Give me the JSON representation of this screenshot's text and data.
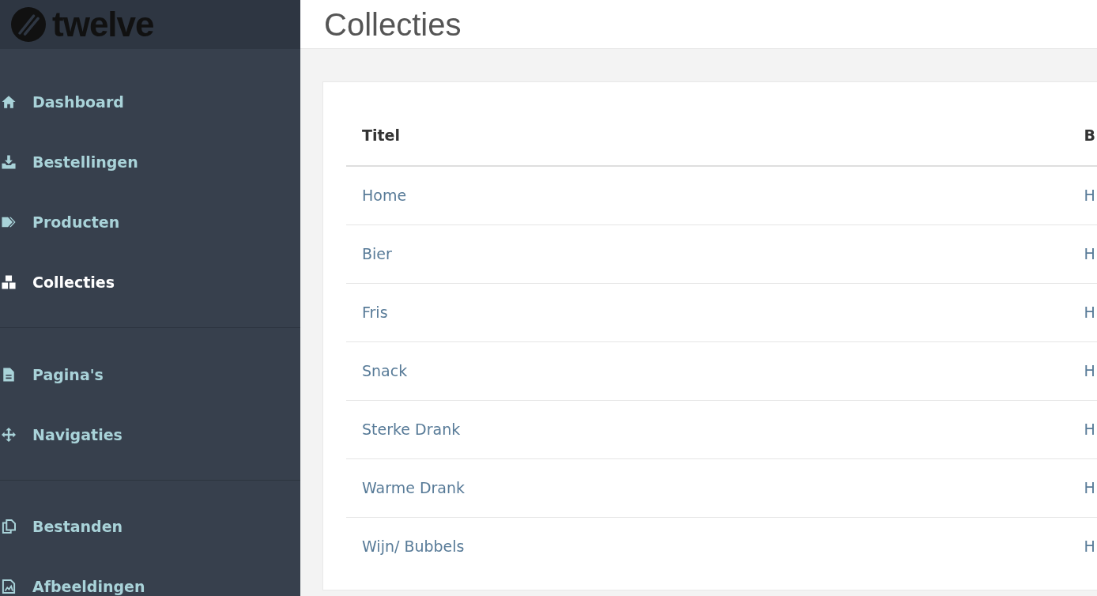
{
  "sidebar": {
    "logo": "twelve",
    "groups": [
      {
        "items": [
          {
            "label": "Dashboard",
            "selected": false
          },
          {
            "label": "Bestellingen",
            "selected": false
          },
          {
            "label": "Producten",
            "selected": false
          },
          {
            "label": "Collecties",
            "selected": true
          }
        ]
      },
      {
        "items": [
          {
            "label": "Pagina's",
            "selected": false
          },
          {
            "label": "Navigaties",
            "selected": false
          }
        ]
      },
      {
        "items": [
          {
            "label": "Bestanden",
            "selected": false
          },
          {
            "label": "Afbeeldingen",
            "selected": false
          }
        ]
      }
    ]
  },
  "page": {
    "title": "Collecties"
  },
  "table": {
    "columns": [
      "Titel",
      "B"
    ],
    "rows": [
      [
        "Home",
        "H"
      ],
      [
        "Bier",
        "H"
      ],
      [
        "Fris",
        "H"
      ],
      [
        "Snack",
        "H"
      ],
      [
        "Sterke Drank",
        "H"
      ],
      [
        "Warme Drank",
        "H"
      ],
      [
        "Wijn/ Bubbels",
        "H"
      ]
    ]
  }
}
